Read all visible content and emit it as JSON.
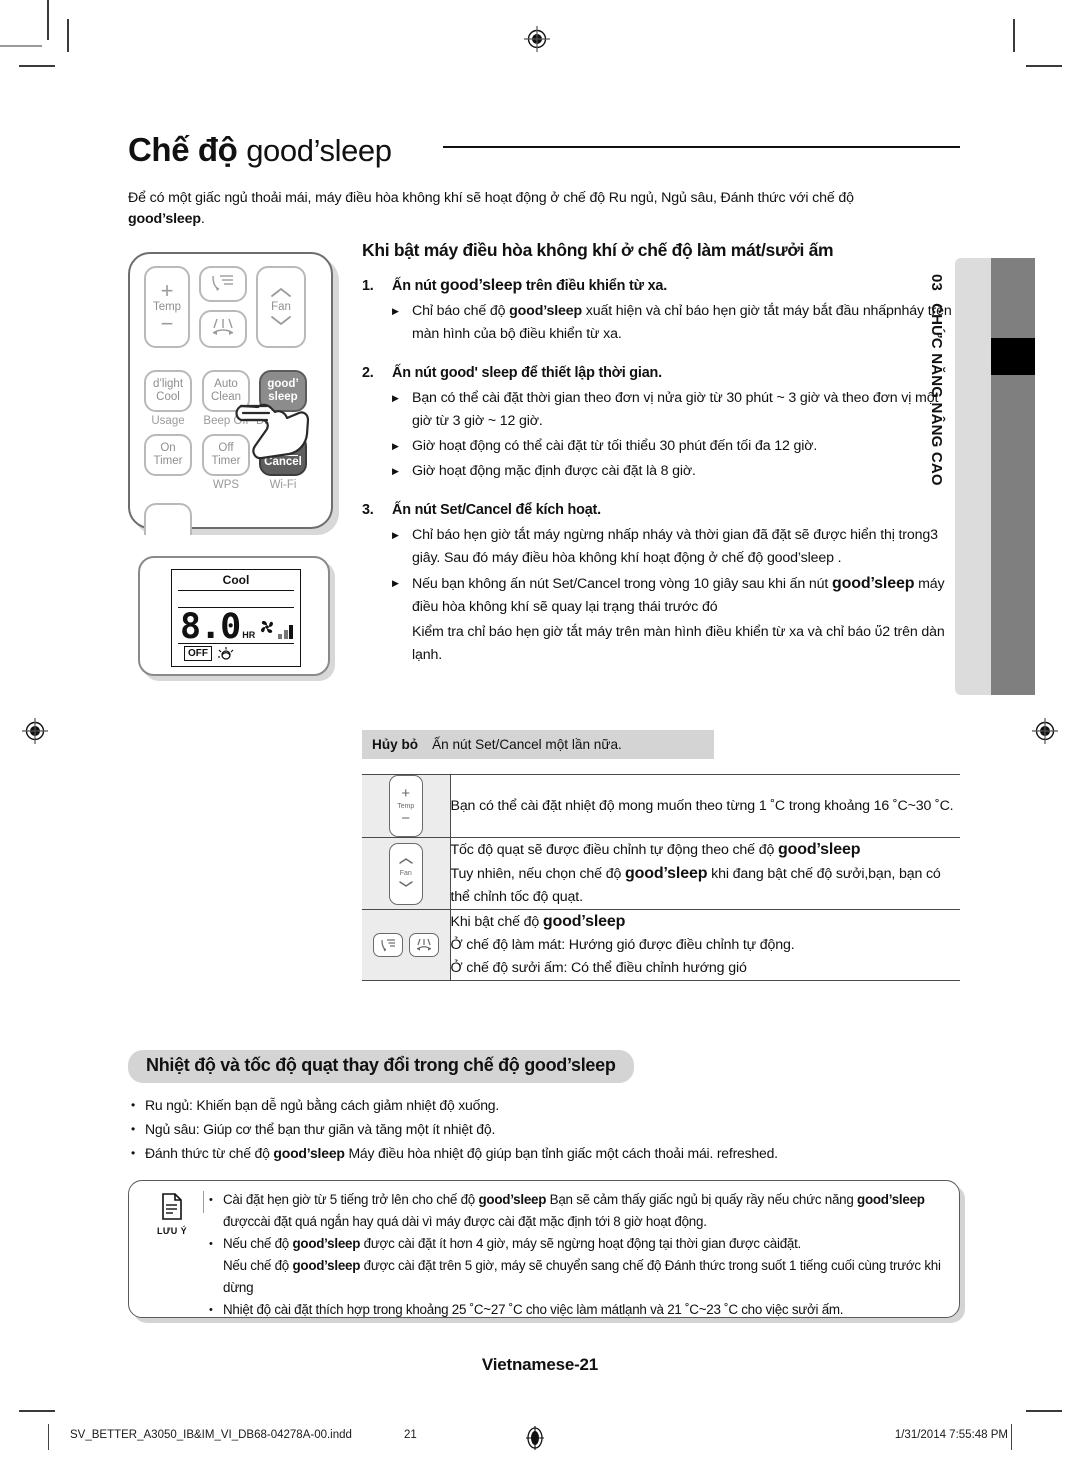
{
  "page": {
    "title_prefix": "Chế độ ",
    "title_brand": "good’sleep",
    "intro_line1": "Để có một giấc ngủ thoải mái, máy điều hòa không khí sẽ hoạt động ở chế độ Ru ngủ, Ngủ sâu, Đánh thức với chế độ",
    "intro_brand": "good’sleep",
    "intro_end": "."
  },
  "remote": {
    "buttons": {
      "temp_plus": "+",
      "temp_label": "Temp",
      "temp_minus": "−",
      "fan_up": "⌃",
      "fan_label": "Fan",
      "fan_down": "⌄",
      "dlight_cool": "d’light\nCool",
      "dlight_line1": "d’light",
      "dlight_line2": "Cool",
      "usage": "Usage",
      "auto_line1": "Auto",
      "auto_line2": "Clean",
      "beep_off": "Beep Off",
      "good_line1": "good’",
      "good_line2": "sleep",
      "display": "Disp",
      "on_line1": "On",
      "on_line2": "Timer",
      "off_line1": "Off",
      "off_line2": "Timer",
      "wps": "WPS",
      "set_line1": "Set",
      "set_line2": "Cancel",
      "wifi": "Wi-Fi"
    }
  },
  "lcd": {
    "mode": "Cool",
    "value": "8.0",
    "unit": "HR",
    "off_badge": "OFF"
  },
  "main": {
    "section_heading": "Khi bật máy điều hòa không khí ở chế độ làm mát/sưởi ấm",
    "steps": [
      {
        "num": "1.",
        "text_before": "Ấn nút ",
        "brand": "good’sleep",
        "text_after": " trên điều khiển từ xa.",
        "bullets": [
          {
            "pre": "Chỉ báo chế độ ",
            "brand": "good’sleep",
            "post": " xuất hiện và chỉ báo hẹn giờ tắt máy bắt đầu nhấpnháy trên màn hình của bộ điều khiển từ xa."
          }
        ]
      },
      {
        "num": "2.",
        "text_before": "Ấn nút ",
        "brand": "good' sleep",
        "text_after": " để thiết lập thời gian.",
        "bullets": [
          {
            "pre": "Bạn có thể cài đặt thời gian theo đơn vị nửa giờ từ 30 phút ~ 3 giờ và theo đơn vị một giờ từ 3 giờ ~ 12 giờ.",
            "brand": "",
            "post": ""
          },
          {
            "pre": "Giờ hoạt động có thể cài đặt từ tối thiểu 30 phút đến tối đa 12 giờ.",
            "brand": "",
            "post": ""
          },
          {
            "pre": "Giờ hoạt động mặc định được cài đặt là 8 giờ.",
            "brand": "",
            "post": ""
          }
        ]
      },
      {
        "num": "3.",
        "text_before": "Ấn nút Set/Cancel để kích hoạt.",
        "brand": "",
        "text_after": "",
        "bullets": [
          {
            "pre": "Chỉ báo hẹn giờ tắt máy ngừng nhấp nháy và thời gian đã đặt sẽ được hiển thị trong3 giây. Sau đó máy điều hòa không khí hoạt động ở chế độ good’sleep .",
            "brand": "",
            "post": ""
          },
          {
            "pre": "Nếu bạn không ấn nút Set/Cancel trong vòng 10 giây sau khi ấn nút ",
            "brand": "good’sleep",
            "post": " máy điều hòa không khí sẽ quay lại trạng thái trước đó"
          },
          {
            "pre": "Kiểm tra chỉ báo hẹn giờ tắt máy trên màn hình điều khiển từ xa và chỉ báo ὕ2 trên dàn lạnh.",
            "brand": "",
            "post": "",
            "nomark": true
          }
        ]
      }
    ],
    "cancel_label": "Hủy bỏ",
    "cancel_text": "Ấn nút Set/Cancel một lần nữa."
  },
  "table": {
    "rows": [
      {
        "icon": "temp-button-icon",
        "lines": [
          {
            "pre": "Bạn có thể cài đặt nhiệt độ mong muốn theo từng 1 ˚C trong khoảng 16 ˚C~30 ˚C.",
            "brand": "",
            "post": ""
          }
        ]
      },
      {
        "icon": "fan-button-icon",
        "lines": [
          {
            "pre": "Tốc độ quạt sẽ được điều chỉnh tự động theo chế độ ",
            "brand": "good’sleep",
            "post": ""
          },
          {
            "pre": "Tuy nhiên, nếu chọn chế độ ",
            "brand": "good’sleep",
            "post": " khi đang bật chế độ sưởi,bạn, bạn có thể chỉnh tốc độ quạt."
          }
        ]
      },
      {
        "icon": "airflow-buttons-icon",
        "lines": [
          {
            "pre": "Khi bật chế độ ",
            "brand": "good’sleep",
            "post": ""
          },
          {
            "pre": "Ở chế độ làm mát: Hướng gió được điều chỉnh tự động.",
            "brand": "",
            "post": ""
          },
          {
            "pre": "Ở chế độ sưởi ấm: Có thể điều chỉnh hướng gió",
            "brand": "",
            "post": ""
          }
        ]
      }
    ]
  },
  "bottom": {
    "heading_pre": "Nhiệt độ và tốc độ quạt thay đổi trong chế độ ",
    "heading_brand": "good’sleep",
    "bullets": [
      {
        "pre": "Ru ngủ: Khiến bạn dễ ngủ bằng cách giảm nhiệt độ xuống.",
        "brand": "",
        "post": ""
      },
      {
        "pre": "Ngủ sâu: Giúp cơ thể bạn thư giãn và tăng một ít nhiệt độ.",
        "brand": "",
        "post": ""
      },
      {
        "pre": "Đánh thức từ chế độ ",
        "brand": "good’sleep",
        "post": " Máy điều hòa nhiệt độ giúp bạn tỉnh giấc một cách thoải mái. refreshed."
      }
    ]
  },
  "note": {
    "icon_caption": "LƯU Ý",
    "items": [
      {
        "pre": "Cài đặt hẹn giờ từ 5 tiếng trở lên cho chế độ ",
        "brand": "good’sleep",
        "mid": " Bạn sẽ cảm thấy giấc ngủ bị quấy rầy nếu chức năng ",
        "brand2": "good’sleep",
        "post": " đượccài đặt quá ngắn hay quá dài vì máy được cài đặt mặc định tới 8 giờ hoạt động."
      },
      {
        "pre": "Nếu chế độ ",
        "brand": "good’sleep",
        "mid": " được cài đặt ít hơn 4 giờ, máy sẽ ngừng hoạt động tại thời gian được càiđặt.",
        "brand2": "",
        "post": ""
      },
      {
        "pre": "Nếu chế độ ",
        "brand": "good’sleep",
        "mid": " được cài đặt trên 5 giờ, máy sẽ chuyển sang chế độ Đánh thức trong suốt 1 tiếng cuối cùng trước khi dừng",
        "brand2": "",
        "post": "",
        "cont": true
      },
      {
        "pre": "Nhiệt độ cài đặt thích hợp trong khoảng 25 ˚C~27 ˚C cho việc làm mátlạnh và 21 ˚C~23 ˚C cho việc sưởi ấm.",
        "brand": "",
        "mid": "",
        "brand2": "",
        "post": ""
      }
    ]
  },
  "sidetab": {
    "number": "03",
    "label": "CHỨC NĂNG NÂNG CAO"
  },
  "footer": {
    "page_label": "Vietnamese-21",
    "file_name": "SV_BETTER_A3050_IB&IM_VI_DB68-04278A-00.indd",
    "page_number": "21",
    "timestamp": "1/31/2014   7:55:48 PM"
  },
  "colors": {
    "gray_bar": "#d4d4d4",
    "side_gray": "#7f7f7f",
    "side_light": "#dcdcdc",
    "accent_black": "#000000"
  }
}
